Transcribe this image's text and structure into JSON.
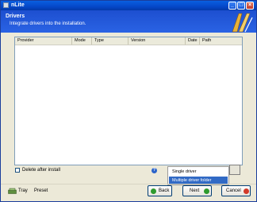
{
  "window": {
    "title": "nLite",
    "minimize_icon": "minimize-icon",
    "maximize_icon": "maximize-icon",
    "close_icon": "close-icon"
  },
  "header": {
    "title": "Drivers",
    "subtitle": "Integrate drivers into the installation."
  },
  "driver_list": {
    "columns": [
      "Provider",
      "Mode",
      "Type",
      "Version",
      "Date",
      "Path"
    ],
    "rows": []
  },
  "options": {
    "delete_after_install_label": "Delete after install",
    "delete_after_install_checked": false
  },
  "insert_menu": {
    "items": [
      "Single driver",
      "Multiple driver folder"
    ],
    "selected_index": 1
  },
  "footer": {
    "tray_label": "Tray",
    "preset_label": "Preset",
    "back_label": "Back",
    "next_label": "Next",
    "cancel_label": "Cancel"
  },
  "colors": {
    "header_blue": "#2a63e4",
    "selection_blue": "#316ac5",
    "back_icon": "#2e9b2e",
    "next_icon": "#2e9b2e",
    "cancel_icon": "#d23a2a"
  }
}
